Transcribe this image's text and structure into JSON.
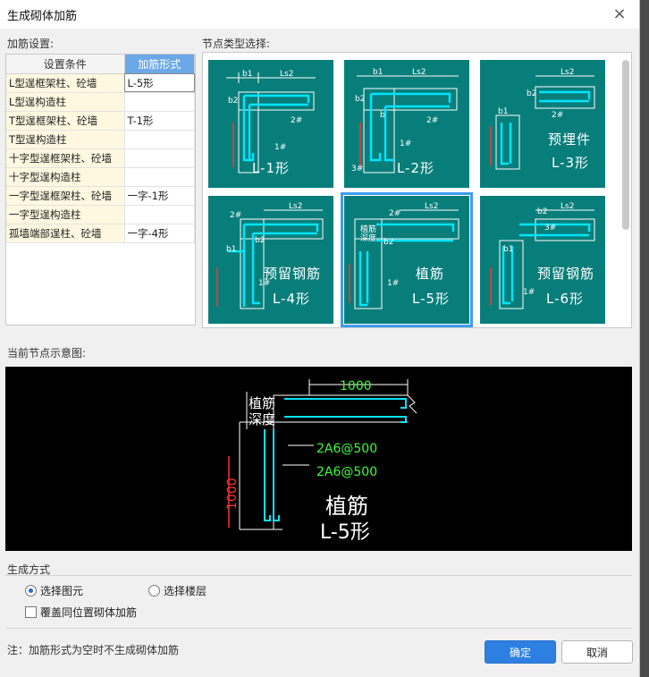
{
  "dialog": {
    "title": "生成砌体加筋",
    "close_glyph": "×"
  },
  "settings": {
    "section_label": "加筋设置:",
    "col_condition": "设置条件",
    "col_form": "加筋形式",
    "rows": [
      {
        "condition": "L型逞框架柱、砼墙",
        "form": "L-5形"
      },
      {
        "condition": "L型逞构造柱",
        "form": ""
      },
      {
        "condition": "T型逞框架柱、砼墙",
        "form": "T-1形"
      },
      {
        "condition": "T型逞构造柱",
        "form": ""
      },
      {
        "condition": "十字型逞框架柱、砼墙",
        "form": ""
      },
      {
        "condition": "十字型逞构造柱",
        "form": ""
      },
      {
        "condition": "一字型逞框架柱、砼墙",
        "form": "一字-1形"
      },
      {
        "condition": "一字型逞构造柱",
        "form": ""
      },
      {
        "condition": "孤墙端部逞柱、砼墙",
        "form": "一字-4形"
      }
    ]
  },
  "nodes": {
    "section_label": "节点类型选择:",
    "tiles": [
      {
        "caption": "L-1形",
        "sub": "",
        "selected": false
      },
      {
        "caption": "L-2形",
        "sub": "",
        "selected": false
      },
      {
        "caption": "L-3形",
        "sub": "预埋件",
        "selected": false
      },
      {
        "caption": "L-4形",
        "sub": "预留钢筋",
        "selected": false
      },
      {
        "caption": "L-5形",
        "sub": "植筋",
        "selected": true
      },
      {
        "caption": "L-6形",
        "sub": "预留钢筋",
        "selected": false
      }
    ],
    "labels": {
      "b1": "b1",
      "b2": "b2",
      "ls2": "Ls2",
      "bar2": "2#",
      "bar1": "1#",
      "bar3": "3#",
      "b": "b",
      "depth_a": "植筋",
      "depth_b": "深度"
    }
  },
  "preview": {
    "section_label": "当前节点示意图:",
    "dim_top": "1000",
    "dim_left": "1000",
    "depth_line1": "植筋",
    "depth_line2": "深度",
    "bar_upper": "2A6@500",
    "bar_lower": "2A6@500",
    "name_line1": "植筋",
    "name_line2": "L-5形"
  },
  "generate": {
    "section_label": "生成方式",
    "option_element": "选择图元",
    "option_floor": "选择楼层",
    "selected": "选择图元",
    "override_label": "覆盖同位置砌体加筋",
    "override_checked": false
  },
  "footer": {
    "note": "注：加筋形式为空时不生成砌体加筋",
    "ok_label": "确定",
    "cancel_label": "取消"
  },
  "colors": {
    "tile_bg": "#087e7a",
    "bar_cyan": "#00e5ff",
    "dim_red": "#ff3030",
    "accent": "#2e7fe2"
  }
}
